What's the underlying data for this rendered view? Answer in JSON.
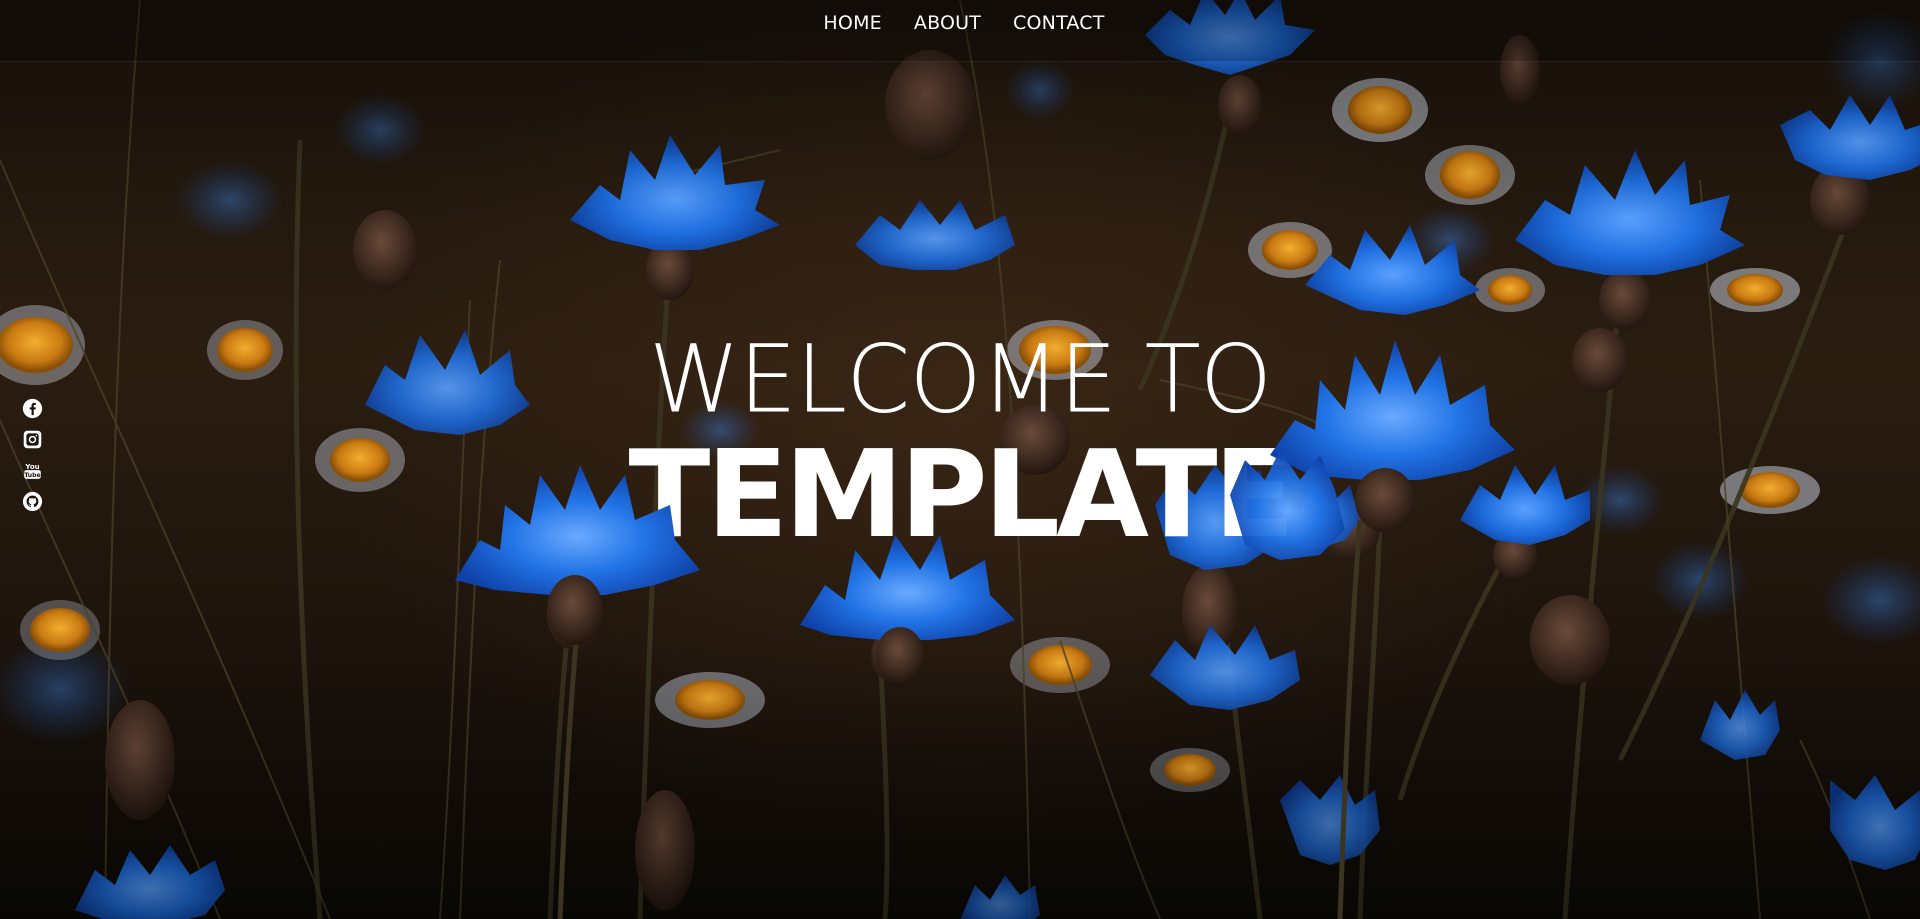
{
  "nav": {
    "items": [
      {
        "label": "HOME"
      },
      {
        "label": "ABOUT"
      },
      {
        "label": "CONTACT"
      }
    ]
  },
  "social": {
    "items": [
      {
        "icon": "facebook-icon"
      },
      {
        "icon": "instagram-icon"
      },
      {
        "icon": "youtube-icon",
        "text": "You Tube"
      },
      {
        "icon": "github-icon"
      }
    ]
  },
  "hero": {
    "line1": "WELCOME TO",
    "line2": "TEMPLATE"
  },
  "colors": {
    "flower_blue": "#1f6fe0",
    "flower_blue_light": "#3f8cf2",
    "daisy_orange": "#e2941c",
    "background": "#1c140c",
    "text": "#ffffff"
  }
}
